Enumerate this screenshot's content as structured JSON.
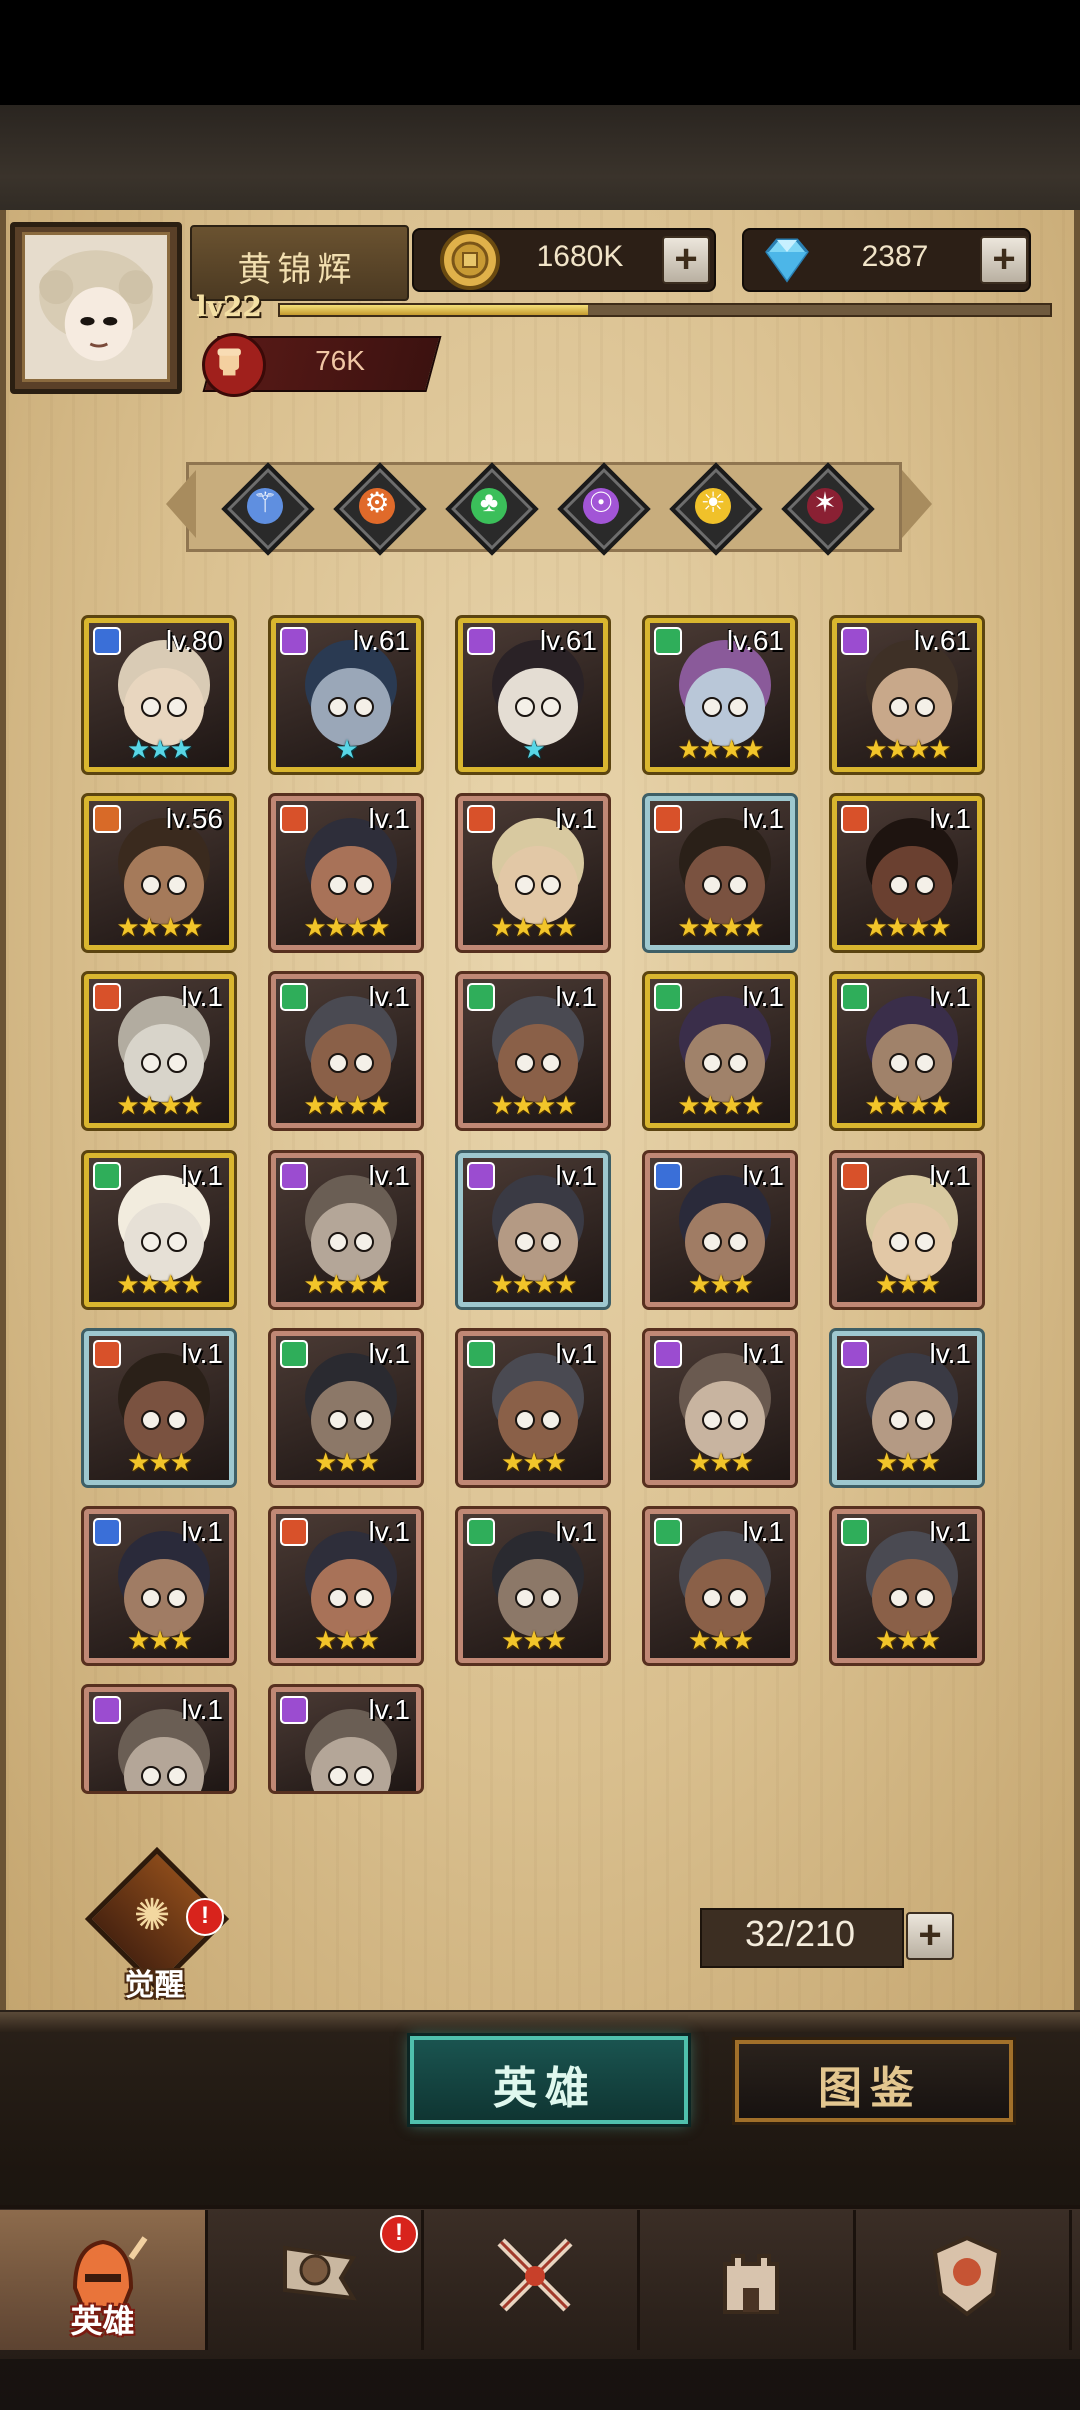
{
  "header": {
    "player_name": "黄锦辉",
    "level": "lv22",
    "xp_fraction": 0.4,
    "gold": "1680K",
    "gems": "2387",
    "power": "76K",
    "icons": {
      "gold": "gold-coin-icon",
      "gems": "diamond-icon",
      "power": "fist-icon",
      "plus": "plus-icon"
    }
  },
  "factions": [
    {
      "name": "faction-blue",
      "color": "#5f8fe0",
      "glyph": "⚚"
    },
    {
      "name": "faction-orange",
      "color": "#e06a2a",
      "glyph": "⚙"
    },
    {
      "name": "faction-green",
      "color": "#3bbf5a",
      "glyph": "♣"
    },
    {
      "name": "faction-purple",
      "color": "#a255d6",
      "glyph": "☉"
    },
    {
      "name": "faction-gold",
      "color": "#f0c12a",
      "glyph": "☀"
    },
    {
      "name": "faction-dark",
      "color": "#8a2033",
      "glyph": "✶"
    }
  ],
  "heroes": [
    {
      "level": "lv.80",
      "stars": "★★★",
      "star_color": "teal",
      "frame": "gold",
      "faction_color": "#3a6fd8",
      "skin": "#e8d6bf",
      "hair": "#d9cbb5"
    },
    {
      "level": "lv.61",
      "stars": "★",
      "star_color": "teal",
      "frame": "gold",
      "faction_color": "#9b4cd0",
      "skin": "#9aa7b8",
      "hair": "#2a3a52"
    },
    {
      "level": "lv.61",
      "stars": "★",
      "star_color": "teal",
      "frame": "gold",
      "faction_color": "#9b4cd0",
      "skin": "#e4ddd3",
      "hair": "#2a2226"
    },
    {
      "level": "lv.61",
      "stars": "★★★★",
      "star_color": "gold",
      "frame": "gold",
      "faction_color": "#2fae5a",
      "skin": "#b9c7d8",
      "hair": "#8a5a9a"
    },
    {
      "level": "lv.61",
      "stars": "★★★★",
      "star_color": "gold",
      "frame": "gold",
      "faction_color": "#9b4cd0",
      "skin": "#c8a88a",
      "hair": "#3e3026"
    },
    {
      "level": "lv.56",
      "stars": "★★★★",
      "star_color": "gold",
      "frame": "gold",
      "faction_color": "#d86a28",
      "skin": "#a57a5a",
      "hair": "#3a2a1e"
    },
    {
      "level": "lv.1",
      "stars": "★★★★",
      "star_color": "gold",
      "frame": "bronze",
      "faction_color": "#d8512a",
      "skin": "#a87258",
      "hair": "#2e2e3a"
    },
    {
      "level": "lv.1",
      "stars": "★★★★",
      "star_color": "gold",
      "frame": "bronze",
      "faction_color": "#d8512a",
      "skin": "#e2c8a6",
      "hair": "#d8c9a0"
    },
    {
      "level": "lv.1",
      "stars": "★★★★",
      "star_color": "gold",
      "frame": "teal",
      "faction_color": "#d8512a",
      "skin": "#7a5240",
      "hair": "#2a2018"
    },
    {
      "level": "lv.1",
      "stars": "★★★★",
      "star_color": "gold",
      "frame": "gold",
      "faction_color": "#d8512a",
      "skin": "#6a4030",
      "hair": "#1e1410"
    },
    {
      "level": "lv.1",
      "stars": "★★★★",
      "star_color": "gold",
      "frame": "gold",
      "faction_color": "#d8512a",
      "skin": "#d8d4ca",
      "hair": "#b2aca0"
    },
    {
      "level": "lv.1",
      "stars": "★★★★",
      "star_color": "gold",
      "frame": "bronze",
      "faction_color": "#2fae5a",
      "skin": "#8a6048",
      "hair": "#4a4a52"
    },
    {
      "level": "lv.1",
      "stars": "★★★★",
      "star_color": "gold",
      "frame": "bronze",
      "faction_color": "#2fae5a",
      "skin": "#8a6048",
      "hair": "#4a4a52"
    },
    {
      "level": "lv.1",
      "stars": "★★★★",
      "star_color": "gold",
      "frame": "gold",
      "faction_color": "#2fae5a",
      "skin": "#a0826a",
      "hair": "#3a2e4a"
    },
    {
      "level": "lv.1",
      "stars": "★★★★",
      "star_color": "gold",
      "frame": "gold",
      "faction_color": "#2fae5a",
      "skin": "#a0826a",
      "hair": "#3a2e4a"
    },
    {
      "level": "lv.1",
      "stars": "★★★★",
      "star_color": "gold",
      "frame": "gold",
      "faction_color": "#2fae5a",
      "skin": "#e6e0d6",
      "hair": "#f2ecde"
    },
    {
      "level": "lv.1",
      "stars": "★★★★",
      "star_color": "gold",
      "frame": "bronze",
      "faction_color": "#9b4cd0",
      "skin": "#b4a698",
      "hair": "#6a5e54"
    },
    {
      "level": "lv.1",
      "stars": "★★★★",
      "star_color": "gold",
      "frame": "teal",
      "faction_color": "#9b4cd0",
      "skin": "#b49a84",
      "hair": "#3a3a44"
    },
    {
      "level": "lv.1",
      "stars": "★★★",
      "star_color": "gold",
      "frame": "bronze",
      "faction_color": "#3a6fd8",
      "skin": "#a07c64",
      "hair": "#2a2a3a"
    },
    {
      "level": "lv.1",
      "stars": "★★★",
      "star_color": "gold",
      "frame": "bronze",
      "faction_color": "#d8512a",
      "skin": "#e2c8a6",
      "hair": "#d8c9a0"
    },
    {
      "level": "lv.1",
      "stars": "★★★",
      "star_color": "gold",
      "frame": "teal",
      "faction_color": "#d8512a",
      "skin": "#7a5240",
      "hair": "#2a2018"
    },
    {
      "level": "lv.1",
      "stars": "★★★",
      "star_color": "gold",
      "frame": "bronze",
      "faction_color": "#2fae5a",
      "skin": "#8c7868",
      "hair": "#2a2a30"
    },
    {
      "level": "lv.1",
      "stars": "★★★",
      "star_color": "gold",
      "frame": "bronze",
      "faction_color": "#2fae5a",
      "skin": "#8a6048",
      "hair": "#4a4a52"
    },
    {
      "level": "lv.1",
      "stars": "★★★",
      "star_color": "gold",
      "frame": "bronze",
      "faction_color": "#9b4cd0",
      "skin": "#c8b4a0",
      "hair": "#6a5a50"
    },
    {
      "level": "lv.1",
      "stars": "★★★",
      "star_color": "gold",
      "frame": "teal",
      "faction_color": "#9b4cd0",
      "skin": "#b49a84",
      "hair": "#3a3a44"
    },
    {
      "level": "lv.1",
      "stars": "★★★",
      "star_color": "gold",
      "frame": "bronze",
      "faction_color": "#3a6fd8",
      "skin": "#a07c64",
      "hair": "#2a2a3a"
    },
    {
      "level": "lv.1",
      "stars": "★★★",
      "star_color": "gold",
      "frame": "bronze",
      "faction_color": "#d8512a",
      "skin": "#a87258",
      "hair": "#2e2e3a"
    },
    {
      "level": "lv.1",
      "stars": "★★★",
      "star_color": "gold",
      "frame": "bronze",
      "faction_color": "#2fae5a",
      "skin": "#8c7868",
      "hair": "#2a2a30"
    },
    {
      "level": "lv.1",
      "stars": "★★★",
      "star_color": "gold",
      "frame": "bronze",
      "faction_color": "#2fae5a",
      "skin": "#8a6048",
      "hair": "#4a4a52"
    },
    {
      "level": "lv.1",
      "stars": "★★★",
      "star_color": "gold",
      "frame": "bronze",
      "faction_color": "#2fae5a",
      "skin": "#8a6048",
      "hair": "#4a4a52"
    },
    {
      "level": "lv.1",
      "stars": "",
      "star_color": "gold",
      "frame": "bronze",
      "faction_color": "#9b4cd0",
      "skin": "#b4a698",
      "hair": "#6a5e54"
    },
    {
      "level": "lv.1",
      "stars": "",
      "star_color": "gold",
      "frame": "bronze",
      "faction_color": "#9b4cd0",
      "skin": "#b4a698",
      "hair": "#6a5e54"
    }
  ],
  "awaken": {
    "label": "觉醒",
    "alert": "!"
  },
  "hero_count": "32/210",
  "tabs": {
    "heroes": "英雄",
    "codex": "图鉴"
  },
  "nav": {
    "items": [
      {
        "label": "英雄",
        "icon": "knight-helmet-icon",
        "active": true
      },
      {
        "label": "",
        "icon": "flag-compass-icon",
        "active": false
      },
      {
        "label": "",
        "icon": "crossed-swords-icon",
        "active": false
      },
      {
        "label": "",
        "icon": "castle-tower-icon",
        "active": false
      },
      {
        "label": "",
        "icon": "alliance-emblem-icon",
        "active": false
      }
    ],
    "alert": "!"
  }
}
